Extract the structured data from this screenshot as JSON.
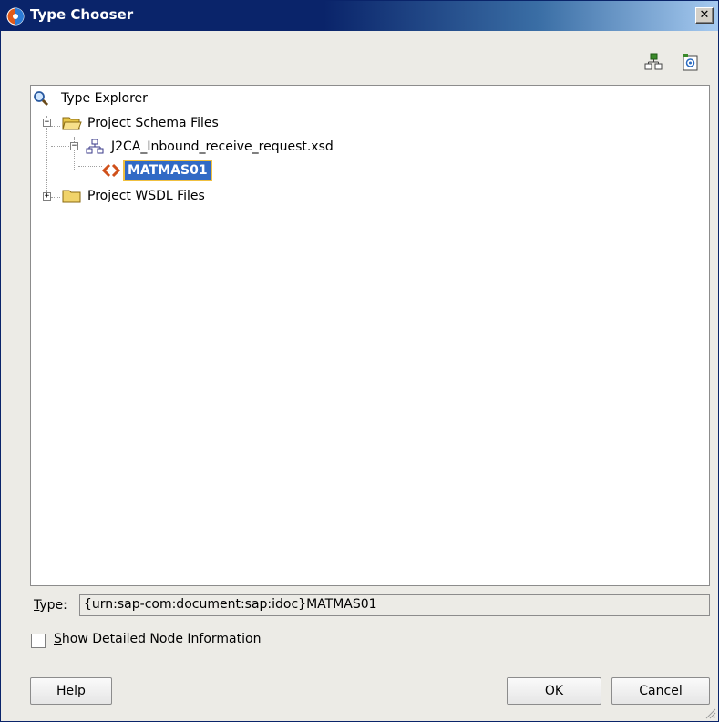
{
  "window": {
    "title": "Type Chooser",
    "close_glyph": "✕"
  },
  "toolbar": {
    "icons": [
      "schema-add-icon",
      "import-wsdl-icon"
    ]
  },
  "tree": {
    "root_label": "Type Explorer",
    "nodes": [
      {
        "label": "Project Schema Files",
        "expanded": true
      },
      {
        "label": "J2CA_Inbound_receive_request.xsd",
        "expanded": true
      },
      {
        "label": "MATMAS01",
        "selected": true
      },
      {
        "label": "Project WSDL Files",
        "expanded": false
      }
    ],
    "expander_minus": "−",
    "expander_plus": "+"
  },
  "type_field": {
    "label_prefix": "T",
    "label_rest": "ype:",
    "value": "{urn:sap-com:document:sap:idoc}MATMAS01"
  },
  "options": {
    "detail_label_prefix": "S",
    "detail_label_rest": "how Detailed Node Information",
    "detail_checked": false
  },
  "buttons": {
    "help_prefix": "H",
    "help_rest": "elp",
    "ok": "OK",
    "cancel": "Cancel"
  },
  "colors": {
    "selection": "#316ac5",
    "titlebar": "#0a246a"
  }
}
